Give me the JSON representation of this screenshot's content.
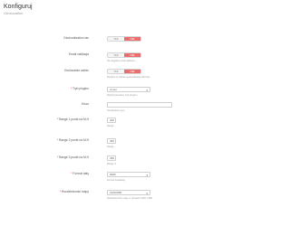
{
  "header": {
    "title": "Konfiguruj",
    "subtitle": "Geolocation"
  },
  "toggles": {
    "one": {
      "label": "Geolocalization lan",
      "off": "TAK",
      "on": "NIE",
      "help": ""
    },
    "two": {
      "label": "Email validacja",
      "off": "TAK",
      "on": "NIE",
      "help": "Na negative email address."
    },
    "three": {
      "label": "Geolocalize admin",
      "off": "TAK",
      "on": "NIE",
      "help": "Wykona to zakres geolocalizacja admina."
    }
  },
  "fields": {
    "f1": {
      "label": "Tryb pluginu",
      "value": "vimeo",
      "help": "Wykorzystywany tryb pluginu"
    },
    "f2": {
      "label": "Klucz",
      "value": "",
      "help": "Geolocation typu"
    },
    "f3": {
      "label": "Range 1 punkt na M.H",
      "value": "300",
      "help": "Range"
    },
    "f4": {
      "label": "Range 2 punkt na M.H",
      "value": "350",
      "help": "Range"
    },
    "f5": {
      "label": "Range 3 punkt na M.H",
      "value": "450",
      "help": "Range 3"
    },
    "f6": {
      "label": "Format daty",
      "value": "9999",
      "help": "Format zasadowy"
    },
    "f7": {
      "label": "Rozdzielczość mapy",
      "value": "1920x880",
      "help": "Rozdzielczość mapy w pixelach 1920 x 880"
    }
  }
}
